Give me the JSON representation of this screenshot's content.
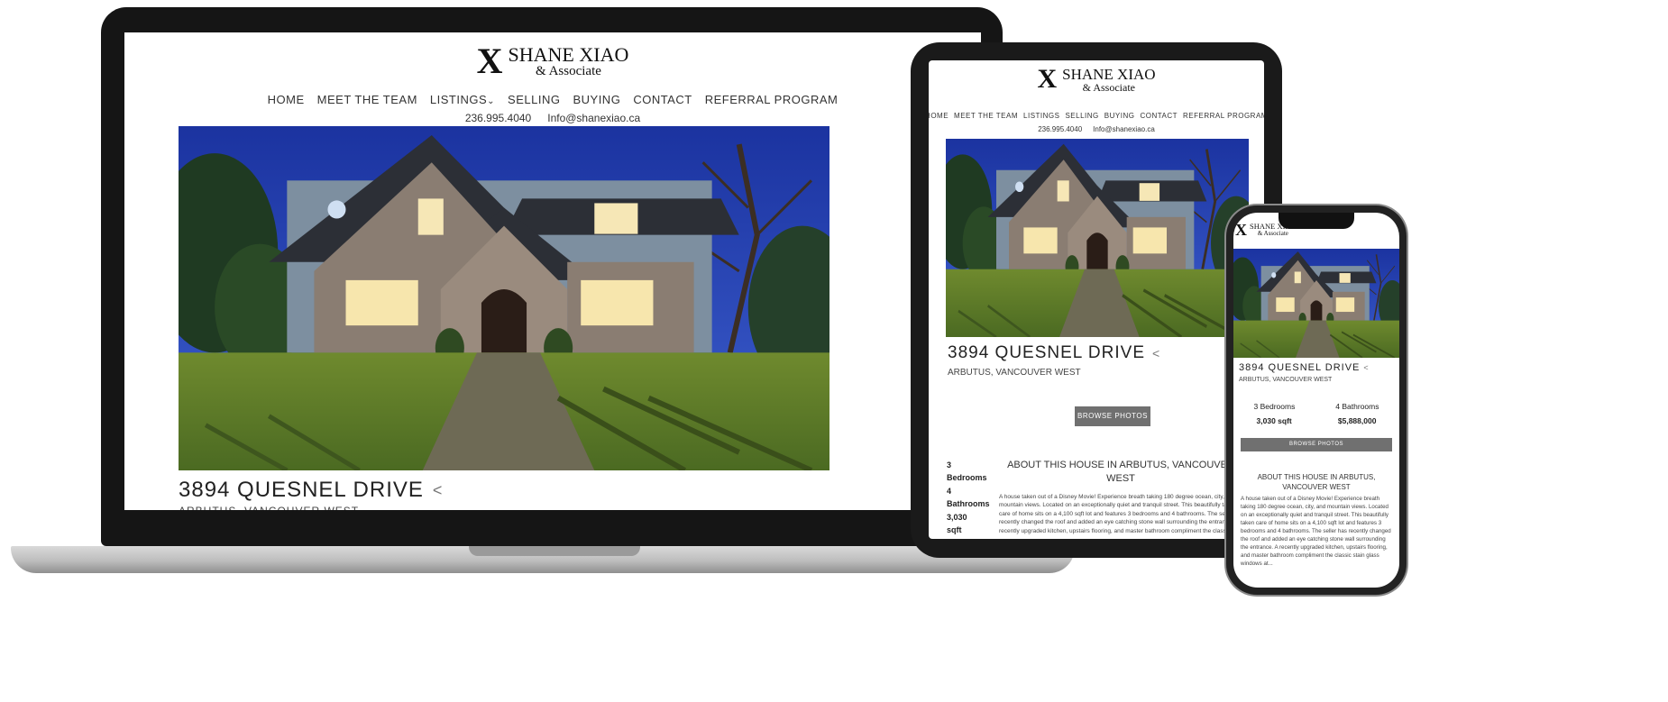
{
  "brand": {
    "mark": "X",
    "name": "SHANE XIAO",
    "sub": "& Associate"
  },
  "nav": {
    "items": [
      "HOME",
      "MEET THE TEAM",
      "LISTINGS",
      "SELLING",
      "BUYING",
      "CONTACT",
      "REFERRAL PROGRAM"
    ],
    "dropdown_glyph": "⌄"
  },
  "contact": {
    "phone": "236.995.4040",
    "email": "Info@shanexiao.ca"
  },
  "listing": {
    "title": "3894 QUESNEL DRIVE",
    "area": "ARBUTUS, VANCOUVER WEST",
    "bedrooms_num": "3",
    "bedrooms_label": "Bedrooms",
    "bedrooms": "3 Bedrooms",
    "bathrooms_num": "4",
    "bathrooms_label": "Bathrooms",
    "bathrooms": "4 Bathrooms",
    "sqft": "3,030 sqft",
    "price": "$5,888,000",
    "browse_button": "BROWSE PHOTOS",
    "about_heading": "ABOUT THIS HOUSE IN ARBUTUS, VANCOUVER WEST",
    "description": "A house taken out of a Disney Movie! Experience breath taking 180 degree ocean, city, and mountain views. Located on an exceptionally quiet and tranquil street. This beautifully taken care of home sits on a 4,100 sqft lot and features 3 bedrooms and 4 bathrooms. The seller has recently changed the roof and added an eye catching stone wall surrounding the entrance. A recently upgraded kitchen, upstairs flooring, and master bathroom compliment the classic stain glass windows at...",
    "share_icon": "share-icon"
  },
  "colors": {
    "button": "#707070",
    "sky": "#1e3aa8",
    "lawn": "#5a7a2a",
    "stone": "#8a7d72"
  }
}
